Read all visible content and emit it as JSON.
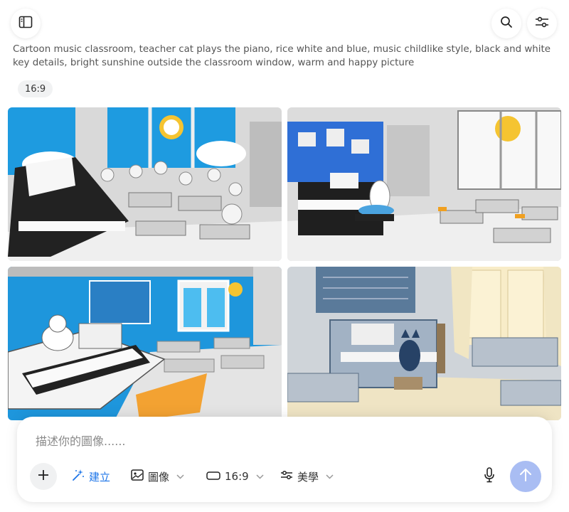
{
  "prompt": {
    "text": "Cartoon music classroom, teacher cat plays the piano, rice white and blue, music childlike style, black and white key details, bright sunshine outside the classroom window, warm and happy picture"
  },
  "ratio_chip": "16:9",
  "composer": {
    "placeholder": "描述你的圖像......",
    "create_label": "建立",
    "image_label": "圖像",
    "ratio_label": "16:9",
    "style_label": "美學"
  },
  "colors": {
    "accent": "#1a73e8",
    "sky_blue": "#1e9be0",
    "sun_yellow": "#f5c431",
    "send_button": "#a9bdf3"
  },
  "icons": {
    "sidebar": "sidebar-toggle-icon",
    "search": "search-icon",
    "filter": "sliders-icon",
    "plus": "plus-icon",
    "create": "sparkle-icon",
    "image": "image-icon",
    "ratio": "aspect-ratio-icon",
    "style": "sliders-icon",
    "mic": "microphone-icon",
    "send": "arrow-up-icon"
  }
}
